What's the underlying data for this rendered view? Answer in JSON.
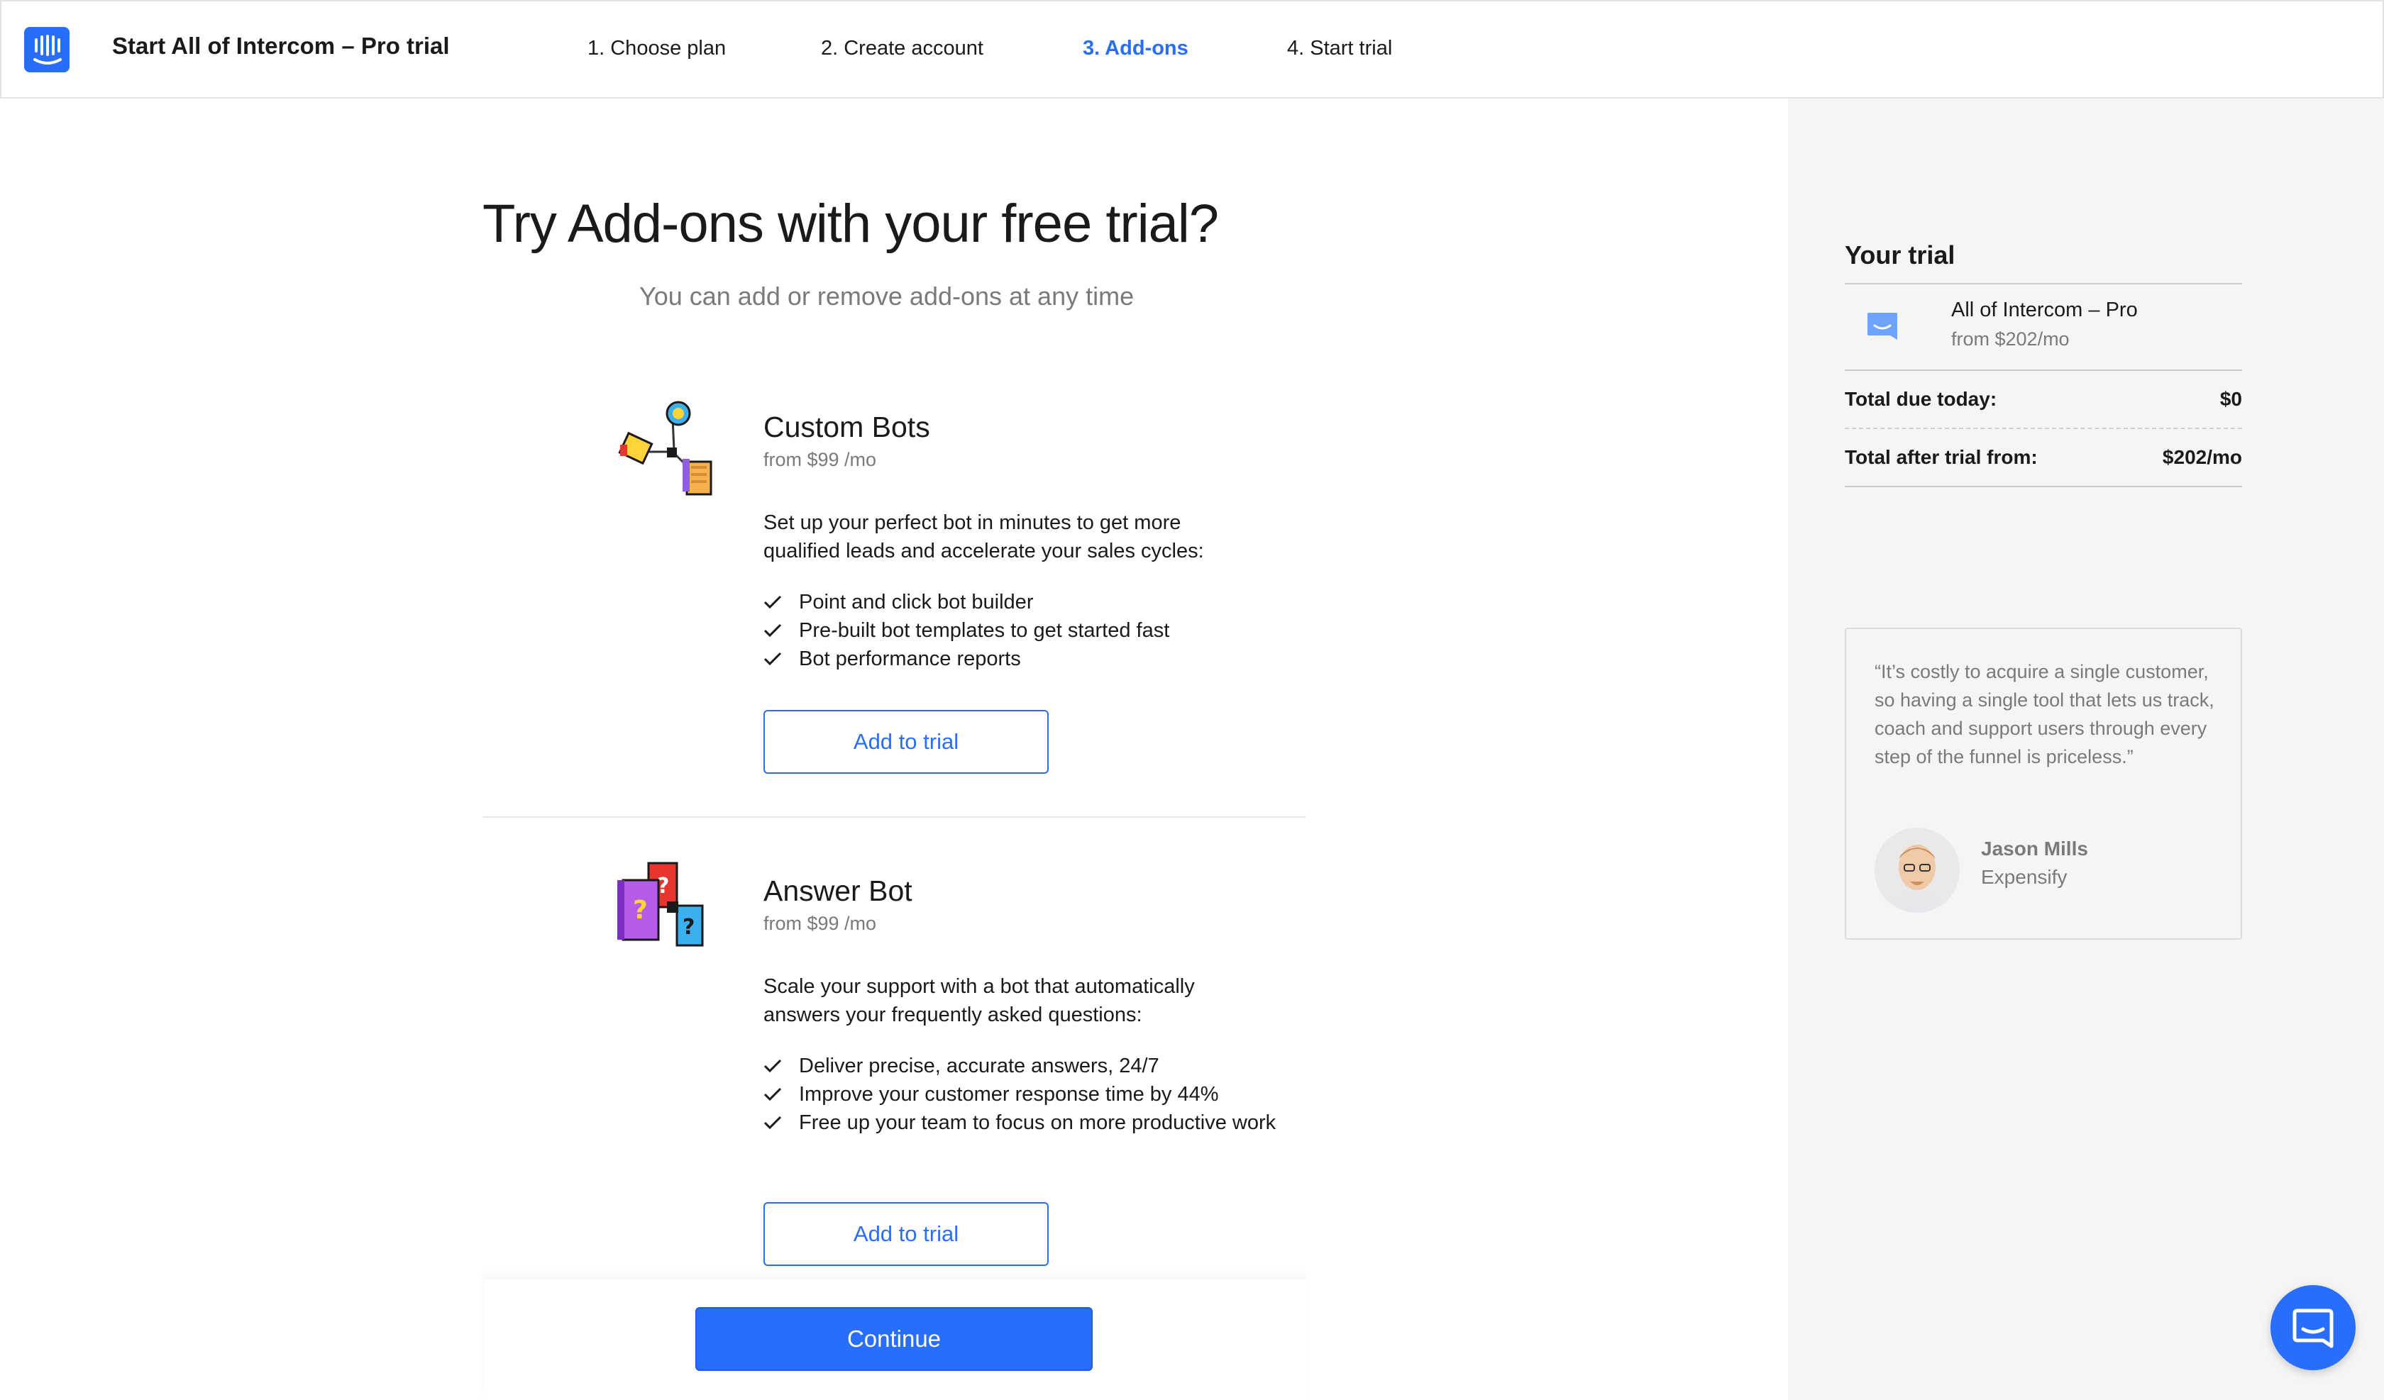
{
  "header": {
    "app_title": "Start All of Intercom – Pro trial",
    "steps": [
      {
        "label": "1. Choose plan",
        "active": false
      },
      {
        "label": "2. Create account",
        "active": false
      },
      {
        "label": "3. Add-ons",
        "active": true
      },
      {
        "label": "4. Start trial",
        "active": false
      }
    ]
  },
  "main": {
    "title": "Try Add-ons with your free trial?",
    "subtitle": "You can add or remove add-ons at any time",
    "addons": [
      {
        "name": "Custom Bots",
        "price": "from $99 /mo",
        "description": "Set up your perfect bot in minutes to get more qualified leads and accelerate your sales cycles:",
        "features": [
          "Point and click bot builder",
          "Pre-built bot templates to get started fast",
          "Bot performance reports"
        ],
        "button_label": "Add to trial",
        "icon": "custom-bots-illustration"
      },
      {
        "name": "Answer Bot",
        "price": "from $99 /mo",
        "description": "Scale your support with a bot that automatically answers your frequently asked questions:",
        "features": [
          "Deliver precise, accurate answers, 24/7",
          "Improve your customer response time by 44%",
          "Free up your team to focus on more productive work"
        ],
        "button_label": "Add to trial",
        "icon": "answer-bot-illustration"
      }
    ],
    "continue_label": "Continue"
  },
  "sidebar": {
    "title": "Your trial",
    "plan": {
      "name": "All of Intercom – Pro",
      "price": "from $202/mo",
      "icon": "intercom-chat-icon"
    },
    "summary": [
      {
        "label": "Total due today:",
        "value": "$0"
      },
      {
        "label": "Total after trial from:",
        "value": "$202/mo"
      }
    ],
    "testimonial": {
      "quote": "“It’s costly to acquire a single customer, so having a single tool that lets us track, coach and support users through every step of the funnel is priceless.”",
      "author": "Jason Mills",
      "company": "Expensify"
    }
  },
  "colors": {
    "accent": "#286efa",
    "sidebar_bg": "#f5f5f5",
    "muted_text": "#7a7a7a"
  },
  "chat_launcher": {
    "icon": "messenger-icon"
  }
}
